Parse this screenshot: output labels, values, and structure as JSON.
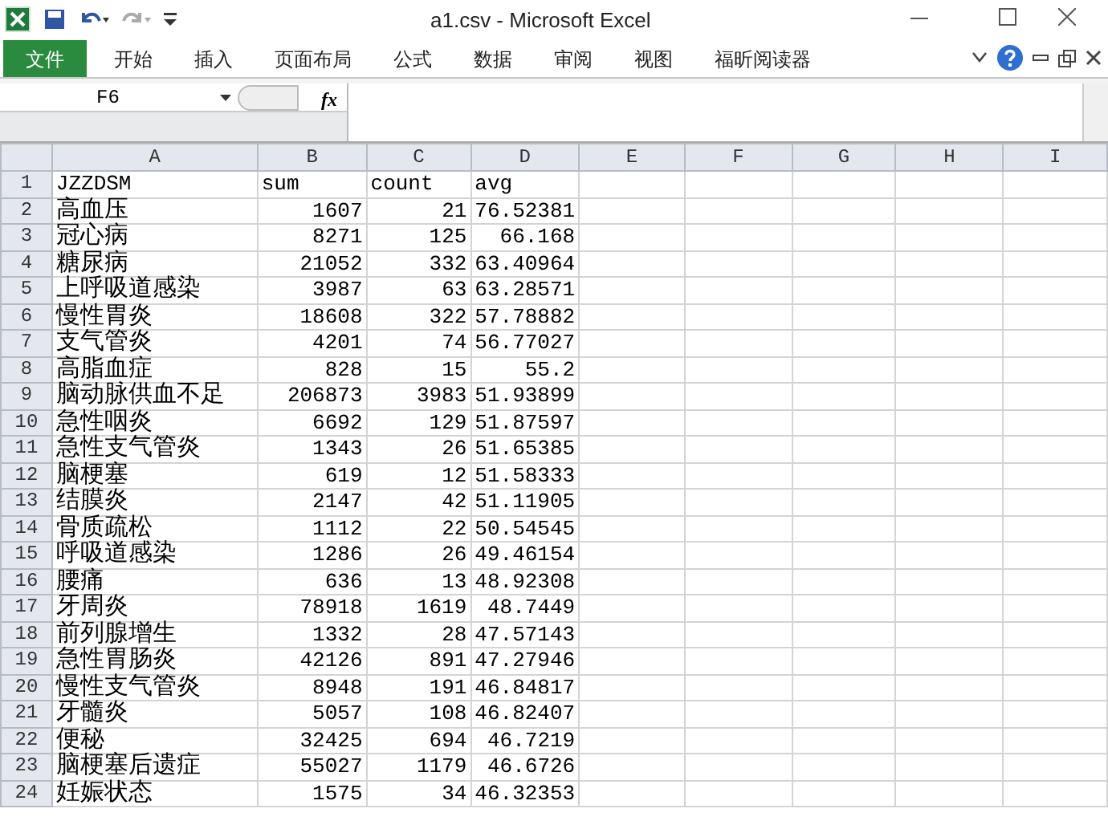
{
  "window": {
    "title": "a1.csv - Microsoft Excel"
  },
  "ribbon": {
    "tabs": [
      {
        "label": "文件",
        "selected": true
      },
      {
        "label": "开始",
        "selected": false
      },
      {
        "label": "插入",
        "selected": false
      },
      {
        "label": "页面布局",
        "selected": false
      },
      {
        "label": "公式",
        "selected": false
      },
      {
        "label": "数据",
        "selected": false
      },
      {
        "label": "审阅",
        "selected": false
      },
      {
        "label": "视图",
        "selected": false
      },
      {
        "label": "福昕阅读器",
        "selected": false
      }
    ]
  },
  "formula_bar": {
    "name_box": "F6",
    "fx": "fx"
  },
  "columns": [
    "A",
    "B",
    "C",
    "D",
    "E",
    "F",
    "G",
    "H",
    "I"
  ],
  "rows": [
    {
      "n": "1",
      "cells": [
        "JZZDSM",
        "sum",
        "count",
        "avg"
      ]
    },
    {
      "n": "2",
      "cells": [
        "高血压",
        "1607",
        "21",
        "76.52381"
      ]
    },
    {
      "n": "3",
      "cells": [
        "冠心病",
        "8271",
        "125",
        "66.168"
      ]
    },
    {
      "n": "4",
      "cells": [
        "糖尿病",
        "21052",
        "332",
        "63.40964"
      ]
    },
    {
      "n": "5",
      "cells": [
        "上呼吸道感染",
        "3987",
        "63",
        "63.28571"
      ]
    },
    {
      "n": "6",
      "cells": [
        "慢性胃炎",
        "18608",
        "322",
        "57.78882"
      ]
    },
    {
      "n": "7",
      "cells": [
        "支气管炎",
        "4201",
        "74",
        "56.77027"
      ]
    },
    {
      "n": "8",
      "cells": [
        "高脂血症",
        "828",
        "15",
        "55.2"
      ]
    },
    {
      "n": "9",
      "cells": [
        "脑动脉供血不足",
        "206873",
        "3983",
        "51.93899"
      ]
    },
    {
      "n": "10",
      "cells": [
        "急性咽炎",
        "6692",
        "129",
        "51.87597"
      ]
    },
    {
      "n": "11",
      "cells": [
        "急性支气管炎",
        "1343",
        "26",
        "51.65385"
      ]
    },
    {
      "n": "12",
      "cells": [
        "脑梗塞",
        "619",
        "12",
        "51.58333"
      ]
    },
    {
      "n": "13",
      "cells": [
        "结膜炎",
        "2147",
        "42",
        "51.11905"
      ]
    },
    {
      "n": "14",
      "cells": [
        "骨质疏松",
        "1112",
        "22",
        "50.54545"
      ]
    },
    {
      "n": "15",
      "cells": [
        "呼吸道感染",
        "1286",
        "26",
        "49.46154"
      ]
    },
    {
      "n": "16",
      "cells": [
        "腰痛",
        "636",
        "13",
        "48.92308"
      ]
    },
    {
      "n": "17",
      "cells": [
        "牙周炎",
        "78918",
        "1619",
        "48.7449"
      ]
    },
    {
      "n": "18",
      "cells": [
        "前列腺增生",
        "1332",
        "28",
        "47.57143"
      ]
    },
    {
      "n": "19",
      "cells": [
        "急性胃肠炎",
        "42126",
        "891",
        "47.27946"
      ]
    },
    {
      "n": "20",
      "cells": [
        "慢性支气管炎",
        "8948",
        "191",
        "46.84817"
      ]
    },
    {
      "n": "21",
      "cells": [
        "牙髓炎",
        "5057",
        "108",
        "46.82407"
      ]
    },
    {
      "n": "22",
      "cells": [
        "便秘",
        "32425",
        "694",
        "46.7219"
      ]
    },
    {
      "n": "23",
      "cells": [
        "脑梗塞后遗症",
        "55027",
        "1179",
        "46.6726"
      ]
    },
    {
      "n": "24",
      "cells": [
        "妊娠状态",
        "1575",
        "34",
        "46.32353"
      ]
    }
  ]
}
